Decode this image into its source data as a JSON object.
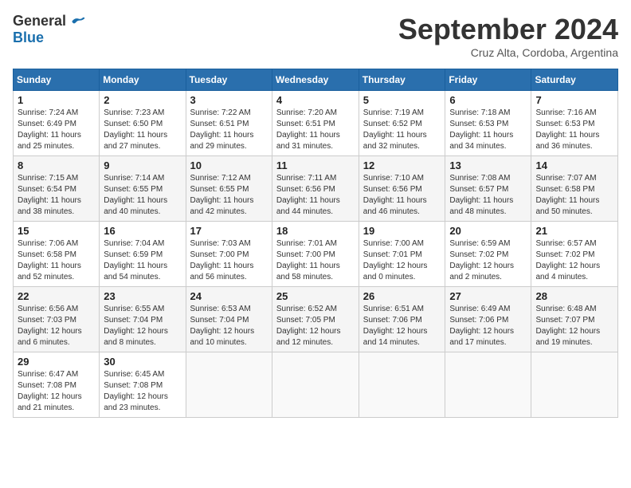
{
  "header": {
    "logo_general": "General",
    "logo_blue": "Blue",
    "month_title": "September 2024",
    "location": "Cruz Alta, Cordoba, Argentina"
  },
  "days_of_week": [
    "Sunday",
    "Monday",
    "Tuesday",
    "Wednesday",
    "Thursday",
    "Friday",
    "Saturday"
  ],
  "weeks": [
    [
      {
        "day": "1",
        "sunrise": "Sunrise: 7:24 AM",
        "sunset": "Sunset: 6:49 PM",
        "daylight": "Daylight: 11 hours and 25 minutes."
      },
      {
        "day": "2",
        "sunrise": "Sunrise: 7:23 AM",
        "sunset": "Sunset: 6:50 PM",
        "daylight": "Daylight: 11 hours and 27 minutes."
      },
      {
        "day": "3",
        "sunrise": "Sunrise: 7:22 AM",
        "sunset": "Sunset: 6:51 PM",
        "daylight": "Daylight: 11 hours and 29 minutes."
      },
      {
        "day": "4",
        "sunrise": "Sunrise: 7:20 AM",
        "sunset": "Sunset: 6:51 PM",
        "daylight": "Daylight: 11 hours and 31 minutes."
      },
      {
        "day": "5",
        "sunrise": "Sunrise: 7:19 AM",
        "sunset": "Sunset: 6:52 PM",
        "daylight": "Daylight: 11 hours and 32 minutes."
      },
      {
        "day": "6",
        "sunrise": "Sunrise: 7:18 AM",
        "sunset": "Sunset: 6:53 PM",
        "daylight": "Daylight: 11 hours and 34 minutes."
      },
      {
        "day": "7",
        "sunrise": "Sunrise: 7:16 AM",
        "sunset": "Sunset: 6:53 PM",
        "daylight": "Daylight: 11 hours and 36 minutes."
      }
    ],
    [
      {
        "day": "8",
        "sunrise": "Sunrise: 7:15 AM",
        "sunset": "Sunset: 6:54 PM",
        "daylight": "Daylight: 11 hours and 38 minutes."
      },
      {
        "day": "9",
        "sunrise": "Sunrise: 7:14 AM",
        "sunset": "Sunset: 6:55 PM",
        "daylight": "Daylight: 11 hours and 40 minutes."
      },
      {
        "day": "10",
        "sunrise": "Sunrise: 7:12 AM",
        "sunset": "Sunset: 6:55 PM",
        "daylight": "Daylight: 11 hours and 42 minutes."
      },
      {
        "day": "11",
        "sunrise": "Sunrise: 7:11 AM",
        "sunset": "Sunset: 6:56 PM",
        "daylight": "Daylight: 11 hours and 44 minutes."
      },
      {
        "day": "12",
        "sunrise": "Sunrise: 7:10 AM",
        "sunset": "Sunset: 6:56 PM",
        "daylight": "Daylight: 11 hours and 46 minutes."
      },
      {
        "day": "13",
        "sunrise": "Sunrise: 7:08 AM",
        "sunset": "Sunset: 6:57 PM",
        "daylight": "Daylight: 11 hours and 48 minutes."
      },
      {
        "day": "14",
        "sunrise": "Sunrise: 7:07 AM",
        "sunset": "Sunset: 6:58 PM",
        "daylight": "Daylight: 11 hours and 50 minutes."
      }
    ],
    [
      {
        "day": "15",
        "sunrise": "Sunrise: 7:06 AM",
        "sunset": "Sunset: 6:58 PM",
        "daylight": "Daylight: 11 hours and 52 minutes."
      },
      {
        "day": "16",
        "sunrise": "Sunrise: 7:04 AM",
        "sunset": "Sunset: 6:59 PM",
        "daylight": "Daylight: 11 hours and 54 minutes."
      },
      {
        "day": "17",
        "sunrise": "Sunrise: 7:03 AM",
        "sunset": "Sunset: 7:00 PM",
        "daylight": "Daylight: 11 hours and 56 minutes."
      },
      {
        "day": "18",
        "sunrise": "Sunrise: 7:01 AM",
        "sunset": "Sunset: 7:00 PM",
        "daylight": "Daylight: 11 hours and 58 minutes."
      },
      {
        "day": "19",
        "sunrise": "Sunrise: 7:00 AM",
        "sunset": "Sunset: 7:01 PM",
        "daylight": "Daylight: 12 hours and 0 minutes."
      },
      {
        "day": "20",
        "sunrise": "Sunrise: 6:59 AM",
        "sunset": "Sunset: 7:02 PM",
        "daylight": "Daylight: 12 hours and 2 minutes."
      },
      {
        "day": "21",
        "sunrise": "Sunrise: 6:57 AM",
        "sunset": "Sunset: 7:02 PM",
        "daylight": "Daylight: 12 hours and 4 minutes."
      }
    ],
    [
      {
        "day": "22",
        "sunrise": "Sunrise: 6:56 AM",
        "sunset": "Sunset: 7:03 PM",
        "daylight": "Daylight: 12 hours and 6 minutes."
      },
      {
        "day": "23",
        "sunrise": "Sunrise: 6:55 AM",
        "sunset": "Sunset: 7:04 PM",
        "daylight": "Daylight: 12 hours and 8 minutes."
      },
      {
        "day": "24",
        "sunrise": "Sunrise: 6:53 AM",
        "sunset": "Sunset: 7:04 PM",
        "daylight": "Daylight: 12 hours and 10 minutes."
      },
      {
        "day": "25",
        "sunrise": "Sunrise: 6:52 AM",
        "sunset": "Sunset: 7:05 PM",
        "daylight": "Daylight: 12 hours and 12 minutes."
      },
      {
        "day": "26",
        "sunrise": "Sunrise: 6:51 AM",
        "sunset": "Sunset: 7:06 PM",
        "daylight": "Daylight: 12 hours and 14 minutes."
      },
      {
        "day": "27",
        "sunrise": "Sunrise: 6:49 AM",
        "sunset": "Sunset: 7:06 PM",
        "daylight": "Daylight: 12 hours and 17 minutes."
      },
      {
        "day": "28",
        "sunrise": "Sunrise: 6:48 AM",
        "sunset": "Sunset: 7:07 PM",
        "daylight": "Daylight: 12 hours and 19 minutes."
      }
    ],
    [
      {
        "day": "29",
        "sunrise": "Sunrise: 6:47 AM",
        "sunset": "Sunset: 7:08 PM",
        "daylight": "Daylight: 12 hours and 21 minutes."
      },
      {
        "day": "30",
        "sunrise": "Sunrise: 6:45 AM",
        "sunset": "Sunset: 7:08 PM",
        "daylight": "Daylight: 12 hours and 23 minutes."
      },
      null,
      null,
      null,
      null,
      null
    ]
  ]
}
